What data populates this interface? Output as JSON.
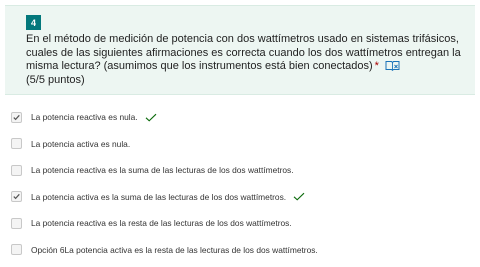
{
  "question": {
    "number": "4",
    "text": "En el método de medición de potencia con dos wattímetros usado en sistemas trifásicos, cuales de las siguientes afirmaciones es correcta cuando los dos wattímetros entregan la misma lectura? (asumimos que los instrumentos está bien conectados)",
    "required_marker": "*",
    "points": "(5/5 puntos)",
    "accent_color": "#03787c",
    "icons": [
      "immersive-reader-icon"
    ]
  },
  "options": [
    {
      "label": "La potencia reactiva es nula.",
      "checked": true,
      "correct": true
    },
    {
      "label": "La potencia activa es nula.",
      "checked": false,
      "correct": false
    },
    {
      "label": "La potencia reactiva es la suma de las lecturas de los dos wattímetros.",
      "checked": false,
      "correct": false
    },
    {
      "label": "La potencia activa es la suma de las lecturas de los dos wattímetros.",
      "checked": true,
      "correct": true
    },
    {
      "label": "La potencia reactiva es la resta de las lecturas de los dos wattímetros.",
      "checked": false,
      "correct": false
    },
    {
      "label": "Opción 6La potencia activa es la resta de las lecturas de los dos wattímetros.",
      "checked": false,
      "correct": false
    }
  ],
  "colors": {
    "card_background": "#edf6f2",
    "correct_mark": "#0b6a0b",
    "checkbox_mark": "#555555"
  }
}
